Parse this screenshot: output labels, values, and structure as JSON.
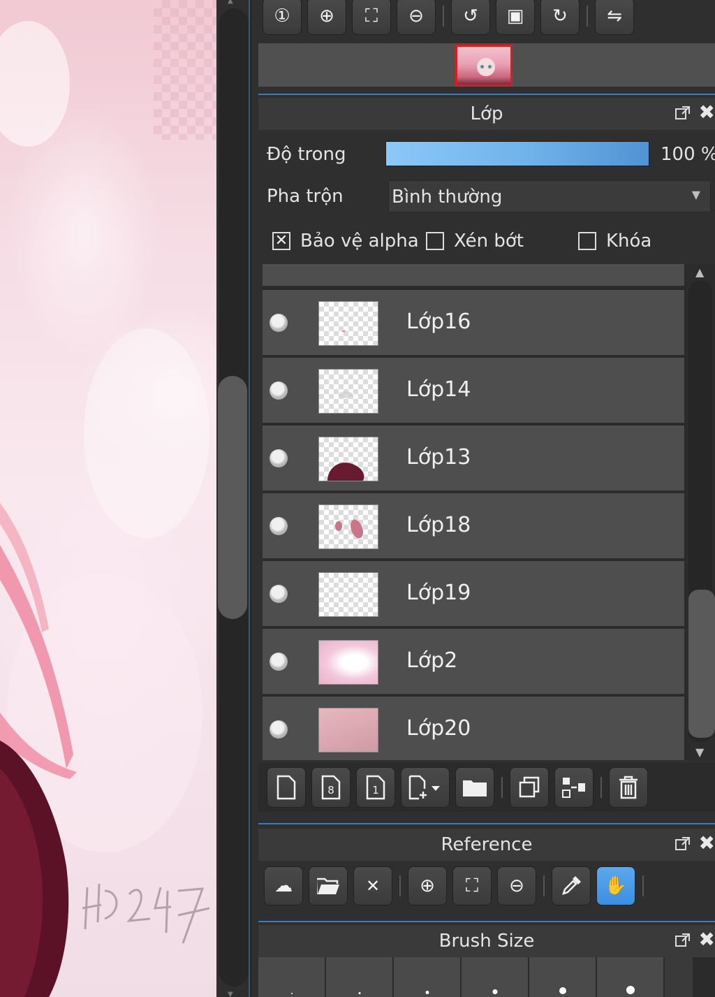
{
  "nav_toolbar": {
    "buttons": [
      {
        "icon": "actual-size-icon",
        "glyph": "①"
      },
      {
        "icon": "zoom-in-icon",
        "glyph": "⊕"
      },
      {
        "icon": "fit-screen-icon",
        "glyph": "⛶"
      },
      {
        "icon": "zoom-out-icon",
        "glyph": "⊖"
      },
      {
        "icon": "rotate-left-icon",
        "glyph": "↺"
      },
      {
        "icon": "reset-view-icon",
        "glyph": "▣"
      },
      {
        "icon": "rotate-right-icon",
        "glyph": "↻"
      },
      {
        "icon": "flip-horizontal-icon",
        "glyph": "⇋"
      }
    ]
  },
  "layer_panel": {
    "title": "Lớp",
    "opacity_label": "Độ trong",
    "opacity_value": "100 %",
    "opacity_level": 1.0,
    "blend_label": "Pha trộn",
    "blend_value": "Bình thường",
    "checkboxes": [
      {
        "label": "Bảo vệ alpha",
        "checked": true
      },
      {
        "label": "Xén bớt",
        "checked": false
      },
      {
        "label": "Khóa",
        "checked": false
      }
    ],
    "layers": [
      {
        "name": "Lớp16"
      },
      {
        "name": "Lớp14"
      },
      {
        "name": "Lớp13"
      },
      {
        "name": "Lớp18"
      },
      {
        "name": "Lớp19"
      },
      {
        "name": "Lớp2"
      },
      {
        "name": "Lớp20"
      }
    ]
  },
  "layer_toolbar": {
    "buttons": [
      {
        "icon": "new-layer-icon"
      },
      {
        "icon": "new-8bit-layer-icon"
      },
      {
        "icon": "new-1bit-layer-icon"
      },
      {
        "icon": "add-layer-menu-icon"
      },
      {
        "icon": "new-folder-icon"
      },
      {
        "icon": "duplicate-layer-icon"
      },
      {
        "icon": "merge-down-icon"
      },
      {
        "icon": "delete-layer-icon"
      }
    ]
  },
  "reference_panel": {
    "title": "Reference",
    "buttons": [
      {
        "icon": "cloud-download-icon"
      },
      {
        "icon": "open-folder-icon"
      },
      {
        "icon": "close-icon"
      },
      {
        "icon": "zoom-in-icon"
      },
      {
        "icon": "fit-screen-icon"
      },
      {
        "icon": "zoom-out-icon"
      },
      {
        "icon": "eyedropper-icon"
      },
      {
        "icon": "hand-icon"
      }
    ]
  },
  "brush_size_panel": {
    "title": "Brush Size"
  },
  "colors": {
    "accent": "#3b7cc0",
    "active_button": "#4a9be6",
    "selection_red": "#e01b1b"
  }
}
